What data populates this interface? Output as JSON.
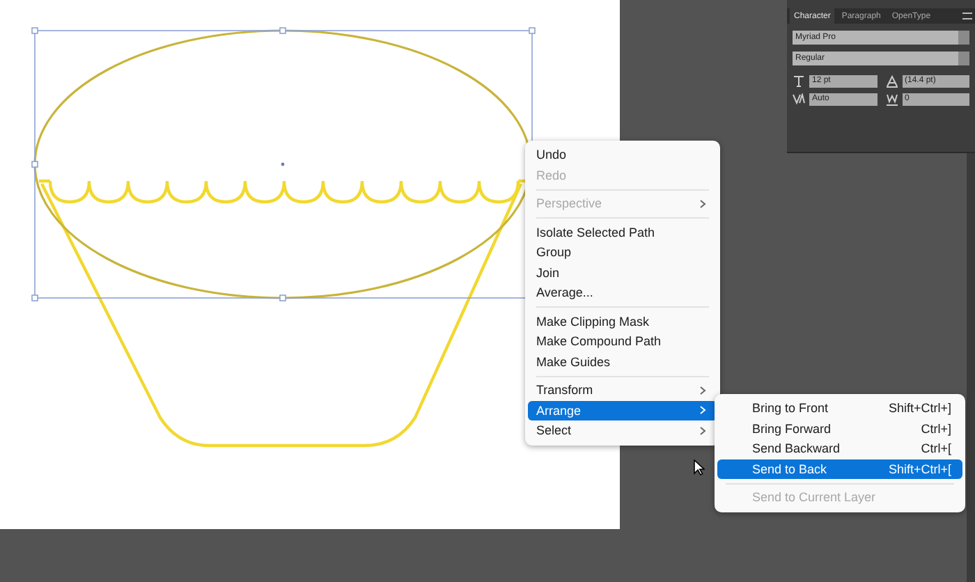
{
  "character_panel": {
    "tabs": [
      {
        "label": "Character",
        "selected": true
      },
      {
        "label": "Paragraph",
        "selected": false
      },
      {
        "label": "OpenType",
        "selected": false
      }
    ],
    "font_family": "Myriad Pro",
    "font_style": "Regular",
    "font_size": "12 pt",
    "leading": "(14.4 pt)",
    "kerning": "Auto",
    "tracking": "0"
  },
  "context_menu": {
    "items": [
      {
        "kind": "item",
        "label": "Undo",
        "disabled": false,
        "submenu": false,
        "selected": false
      },
      {
        "kind": "item",
        "label": "Redo",
        "disabled": true,
        "submenu": false,
        "selected": false
      },
      {
        "kind": "separator"
      },
      {
        "kind": "item",
        "label": "Perspective",
        "disabled": true,
        "submenu": true,
        "selected": false
      },
      {
        "kind": "separator"
      },
      {
        "kind": "item",
        "label": "Isolate Selected Path",
        "disabled": false,
        "submenu": false,
        "selected": false
      },
      {
        "kind": "item",
        "label": "Group",
        "disabled": false,
        "submenu": false,
        "selected": false
      },
      {
        "kind": "item",
        "label": "Join",
        "disabled": false,
        "submenu": false,
        "selected": false
      },
      {
        "kind": "item",
        "label": "Average...",
        "disabled": false,
        "submenu": false,
        "selected": false
      },
      {
        "kind": "separator"
      },
      {
        "kind": "item",
        "label": "Make Clipping Mask",
        "disabled": false,
        "submenu": false,
        "selected": false
      },
      {
        "kind": "item",
        "label": "Make Compound Path",
        "disabled": false,
        "submenu": false,
        "selected": false
      },
      {
        "kind": "item",
        "label": "Make Guides",
        "disabled": false,
        "submenu": false,
        "selected": false
      },
      {
        "kind": "separator"
      },
      {
        "kind": "item",
        "label": "Transform",
        "disabled": false,
        "submenu": true,
        "selected": false
      },
      {
        "kind": "item",
        "label": "Arrange",
        "disabled": false,
        "submenu": true,
        "selected": true
      },
      {
        "kind": "item",
        "label": "Select",
        "disabled": false,
        "submenu": true,
        "selected": false
      }
    ]
  },
  "arrange_submenu": {
    "items": [
      {
        "kind": "item",
        "label": "Bring to Front",
        "shortcut": "Shift+Ctrl+]",
        "disabled": false,
        "selected": false
      },
      {
        "kind": "item",
        "label": "Bring Forward",
        "shortcut": "Ctrl+]",
        "disabled": false,
        "selected": false
      },
      {
        "kind": "item",
        "label": "Send Backward",
        "shortcut": "Ctrl+[",
        "disabled": false,
        "selected": false
      },
      {
        "kind": "item",
        "label": "Send to Back",
        "shortcut": "Shift+Ctrl+[",
        "disabled": false,
        "selected": true
      },
      {
        "kind": "separator"
      },
      {
        "kind": "item",
        "label": "Send to Current Layer",
        "disabled": true,
        "selected": false
      }
    ]
  }
}
